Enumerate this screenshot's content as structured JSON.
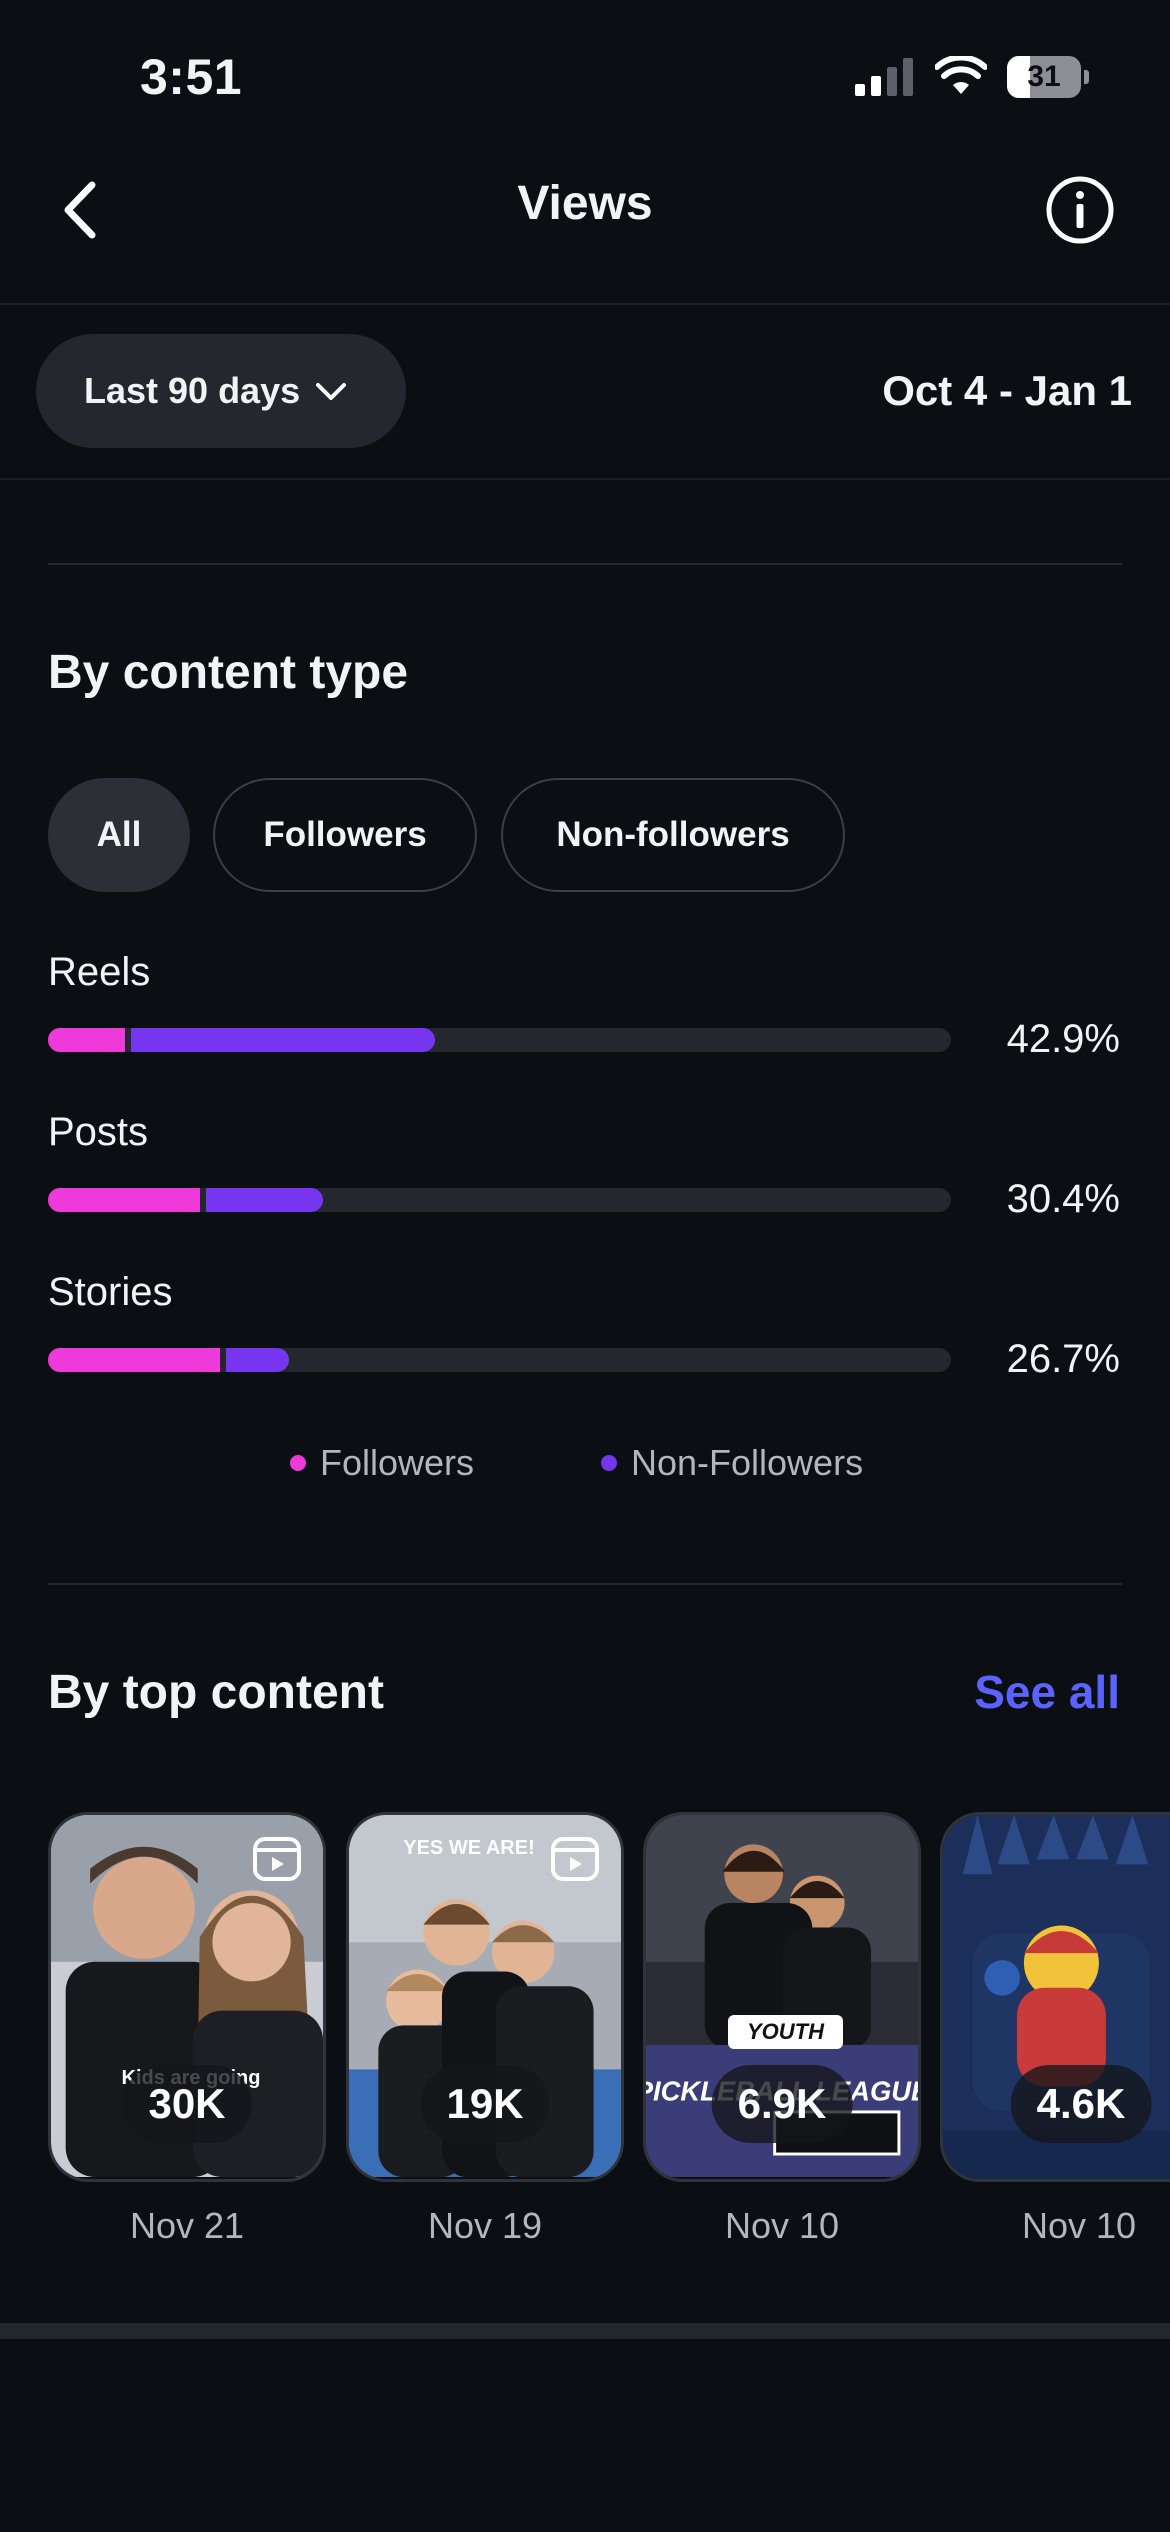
{
  "status": {
    "time": "3:51",
    "battery": "31",
    "battery_level": 0.31
  },
  "nav": {
    "title": "Views",
    "back_icon": "chevron-left-icon",
    "info_icon": "info-icon"
  },
  "filter": {
    "range_label": "Last 90 days",
    "date_range": "Oct 4 - Jan 1"
  },
  "content_type": {
    "title": "By content type",
    "tabs": [
      "All",
      "Followers",
      "Non-followers"
    ],
    "active_tab": "All",
    "rows": [
      {
        "label": "Reels",
        "percent": "42.9%",
        "followers": 8.5,
        "non_followers": 34.4
      },
      {
        "label": "Posts",
        "percent": "30.4%",
        "followers": 16.8,
        "non_followers": 13.6
      },
      {
        "label": "Stories",
        "percent": "26.7%",
        "followers": 19.0,
        "non_followers": 7.7
      }
    ],
    "legend": [
      {
        "label": "Followers",
        "color": "#ee3ad8"
      },
      {
        "label": "Non-Followers",
        "color": "#7735f0"
      }
    ]
  },
  "top_content": {
    "title": "By top content",
    "see_all": "See all",
    "items": [
      {
        "count": "30K",
        "date": "Nov 21",
        "caption": "Kids are going",
        "type": "reel"
      },
      {
        "count": "19K",
        "date": "Nov 19",
        "caption": "YES WE ARE!",
        "type": "reel"
      },
      {
        "count": "6.9K",
        "date": "Nov 10",
        "caption": "PICKLEBALL LEAGUE",
        "badge": "YOUTH",
        "type": "post"
      },
      {
        "count": "4.6K",
        "date": "Nov 10",
        "type": "post"
      }
    ]
  }
}
